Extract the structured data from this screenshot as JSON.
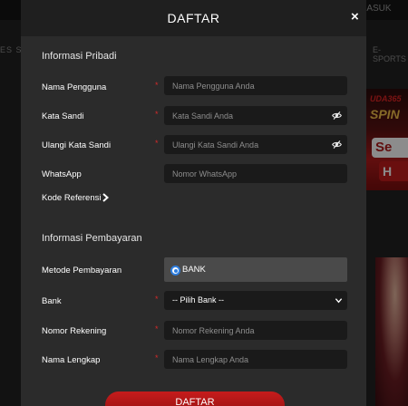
{
  "background": {
    "login_label": "MASUK",
    "nav_left": "ES  S",
    "nav_right": "E-SPORTS",
    "banner": {
      "brand": "UDA365",
      "line1": "SPIN",
      "line2": "Se",
      "line3": "H"
    }
  },
  "modal": {
    "title": "DAFTAR",
    "close_label": "×",
    "personal": {
      "heading": "Informasi Pribadi",
      "fields": [
        {
          "label": "Nama Pengguna",
          "required_mark": "*",
          "placeholder": "Nama Pengguna Anda",
          "value": ""
        },
        {
          "label": "Kata Sandi",
          "required_mark": "*",
          "placeholder": "Kata Sandi Anda",
          "value": ""
        },
        {
          "label": "Ulangi Kata Sandi",
          "required_mark": "*",
          "placeholder": "Ulangi Kata Sandi Anda",
          "value": ""
        },
        {
          "label": "WhatsApp",
          "required_mark": "",
          "placeholder": "Nomor WhatsApp",
          "value": ""
        }
      ],
      "referral_label": "Kode Referensi"
    },
    "payment": {
      "heading": "Informasi Pembayaran",
      "method_label": "Metode Pembayaran",
      "method_option": "BANK",
      "bank_label": "Bank",
      "bank_required_mark": "*",
      "bank_selected": "-- Pilih Bank --",
      "fields": [
        {
          "label": "Nomor Rekening",
          "required_mark": "*",
          "placeholder": "Nomor Rekening Anda",
          "value": ""
        },
        {
          "label": "Nama Lengkap",
          "required_mark": "*",
          "placeholder": "Nama Lengkap Anda",
          "value": ""
        }
      ]
    },
    "submit_label": "DAFTAR"
  },
  "icons": {
    "close": "close-icon",
    "eye_hidden": "eye-slash-icon",
    "chevron_right": "chevron-right-icon",
    "chevron_down": "chevron-down-icon"
  },
  "colors": {
    "modal_bg": "#2b2b2b",
    "header_bg": "#1f1f1f",
    "input_bg": "#1a1a1a",
    "required": "#d42a2a",
    "radio_accent": "#2f7fe0",
    "button_red": "#c61c1c"
  }
}
